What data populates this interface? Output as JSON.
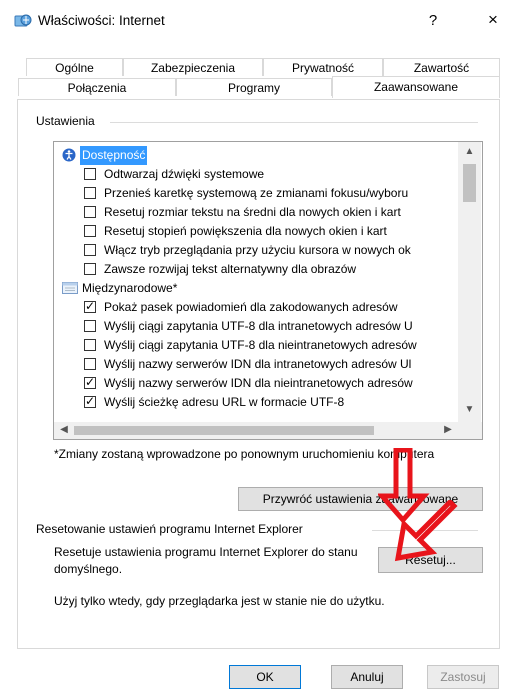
{
  "window": {
    "title": "Właściwości: Internet",
    "help_label": "?",
    "close_label": "×"
  },
  "tabs_row1": [
    {
      "label": "Ogólne"
    },
    {
      "label": "Zabezpieczenia"
    },
    {
      "label": "Prywatność"
    },
    {
      "label": "Zawartość"
    }
  ],
  "tabs_row2": [
    {
      "label": "Połączenia"
    },
    {
      "label": "Programy"
    },
    {
      "label": "Zaawansowane",
      "active": true
    }
  ],
  "settings": {
    "group_label": "Ustawienia",
    "items": [
      {
        "type": "category",
        "label": "Dostępność",
        "icon": "accessibility-icon",
        "selected": true
      },
      {
        "type": "checkbox",
        "label": "Odtwarzaj dźwięki systemowe",
        "checked": false
      },
      {
        "type": "checkbox",
        "label": "Przenieś karetkę systemową ze zmianami fokusu/wyboru",
        "checked": false
      },
      {
        "type": "checkbox",
        "label": "Resetuj rozmiar tekstu na średni dla nowych okien i kart",
        "checked": false
      },
      {
        "type": "checkbox",
        "label": "Resetuj stopień powiększenia dla nowych okien i kart",
        "checked": false
      },
      {
        "type": "checkbox",
        "label": "Włącz tryb przeglądania przy użyciu kursora w nowych ok",
        "checked": false
      },
      {
        "type": "checkbox",
        "label": "Zawsze rozwijaj tekst alternatywny dla obrazów",
        "checked": false
      },
      {
        "type": "category",
        "label": "Międzynarodowe*",
        "icon": "international-icon",
        "selected": false
      },
      {
        "type": "checkbox",
        "label": "Pokaż pasek powiadomień dla zakodowanych adresów",
        "checked": true
      },
      {
        "type": "checkbox",
        "label": "Wyślij ciągi zapytania UTF-8 dla intranetowych adresów U",
        "checked": false
      },
      {
        "type": "checkbox",
        "label": "Wyślij ciągi zapytania UTF-8 dla nieintranetowych adresów",
        "checked": false
      },
      {
        "type": "checkbox",
        "label": "Wyślij nazwy serwerów IDN dla intranetowych adresów Ul",
        "checked": false
      },
      {
        "type": "checkbox",
        "label": "Wyślij nazwy serwerów IDN dla nieintranetowych adresów",
        "checked": true
      },
      {
        "type": "checkbox",
        "label": "Wyślij ścieżkę adresu URL w formacie UTF-8",
        "checked": true
      }
    ],
    "note": "*Zmiany zostaną wprowadzone po ponownym uruchomieniu komputera",
    "restore_button": "Przywróć ustawienia zaawansowane"
  },
  "reset": {
    "group_label": "Resetowanie ustawień programu Internet Explorer",
    "description": "Resetuje ustawienia programu Internet Explorer do stanu domyślnego.",
    "button": "Resetuj...",
    "warning": "Użyj tylko wtedy, gdy przeglądarka jest w stanie nie do użytku."
  },
  "footer": {
    "ok": "OK",
    "cancel": "Anuluj",
    "apply": "Zastosuj"
  },
  "colors": {
    "selection": "#3399ff",
    "annotation_arrow": "#e8141b"
  }
}
